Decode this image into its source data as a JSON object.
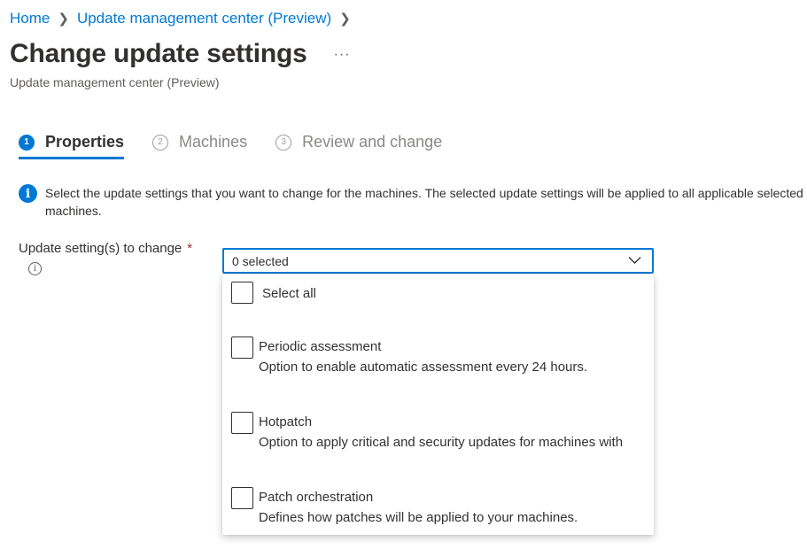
{
  "breadcrumb": {
    "home": "Home",
    "parent": "Update management center (Preview)"
  },
  "header": {
    "title": "Change update settings",
    "more": "···",
    "subtitle": "Update management center (Preview)"
  },
  "steps": [
    {
      "number": "1",
      "label": "Properties",
      "state": "active"
    },
    {
      "number": "2",
      "label": "Machines",
      "state": "inactive"
    },
    {
      "number": "3",
      "label": "Review and change",
      "state": "inactive"
    }
  ],
  "info": {
    "text": "Select the update settings that you want to change for the machines. The selected update settings will be applied to all applicable selected machines."
  },
  "field": {
    "label": "Update setting(s) to change",
    "required_mark": "*",
    "info_glyph": "i",
    "value": "0 selected"
  },
  "options": {
    "select_all": "Select all",
    "items": [
      {
        "label": "Periodic assessment",
        "description": "Option to enable automatic assessment every 24 hours.",
        "checked": false
      },
      {
        "label": "Hotpatch",
        "description": "Option to apply critical and security updates for machines with",
        "checked": false
      },
      {
        "label": "Patch orchestration",
        "description": "Defines how patches will be applied to your machines.",
        "checked": false
      }
    ]
  },
  "colors": {
    "accent": "#0078d4",
    "required": "#a4262c",
    "text": "#323130",
    "muted": "#8a8886"
  }
}
